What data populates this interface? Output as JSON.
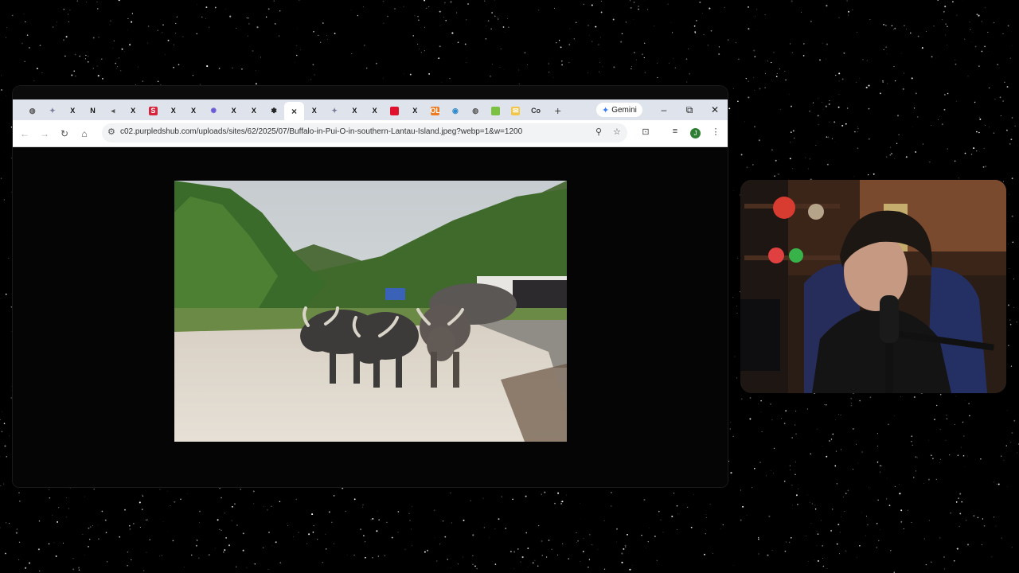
{
  "browser": {
    "tabs": [
      {
        "icon": "globe-icon",
        "glyph": "◍",
        "color": "#555555"
      },
      {
        "icon": "puzzle-favicon-icon",
        "glyph": "✦",
        "color": "#7a7a9a"
      },
      {
        "icon": "x-favicon-icon",
        "glyph": "X",
        "color": "#111111"
      },
      {
        "icon": "notion-favicon-icon",
        "glyph": "N",
        "color": "#111111"
      },
      {
        "icon": "speaker-favicon-icon",
        "glyph": "◂",
        "color": "#555555"
      },
      {
        "icon": "x-favicon-icon",
        "glyph": "X",
        "color": "#111111"
      },
      {
        "icon": "s-favicon-icon",
        "glyph": "S",
        "color": "#d6243c"
      },
      {
        "icon": "x-favicon-icon",
        "glyph": "X",
        "color": "#111111"
      },
      {
        "icon": "x-favicon-icon",
        "glyph": "X",
        "color": "#111111"
      },
      {
        "icon": "gear-favicon-icon",
        "glyph": "✺",
        "color": "#6b5bd6"
      },
      {
        "icon": "x-favicon-icon",
        "glyph": "X",
        "color": "#111111"
      },
      {
        "icon": "x-favicon-icon",
        "glyph": "X",
        "color": "#111111"
      },
      {
        "icon": "paw-favicon-icon",
        "glyph": "✽",
        "color": "#222222"
      },
      {
        "icon": "close-icon",
        "glyph": "×",
        "color": "#333333",
        "active": true
      },
      {
        "icon": "x-favicon-icon",
        "glyph": "X",
        "color": "#111111"
      },
      {
        "icon": "puzzle-favicon-icon",
        "glyph": "✦",
        "color": "#7a7a9a"
      },
      {
        "icon": "x-favicon-icon",
        "glyph": "X",
        "color": "#111111"
      },
      {
        "icon": "x-favicon-icon",
        "glyph": "X",
        "color": "#111111"
      },
      {
        "icon": "red-square-favicon-icon",
        "glyph": "",
        "color": "#e0102e"
      },
      {
        "icon": "x-favicon-icon",
        "glyph": "X",
        "color": "#111111"
      },
      {
        "icon": "orange-favicon-icon",
        "glyph": "OL",
        "color": "#ee7b22"
      },
      {
        "icon": "circle-favicon-icon",
        "glyph": "◉",
        "color": "#2f8ac9"
      },
      {
        "icon": "globe-icon",
        "glyph": "◍",
        "color": "#555555"
      },
      {
        "icon": "green-square-favicon-icon",
        "glyph": "",
        "color": "#7cc242"
      },
      {
        "icon": "yellow-favicon-icon",
        "glyph": "✉",
        "color": "#f3c64a"
      },
      {
        "icon": "co-favicon-icon",
        "glyph": "Co",
        "color": "#333333"
      }
    ],
    "new_tab": "+",
    "gemini_label": "Gemini",
    "url": "c02.purpledshub.com/uploads/sites/62/2025/07/Buffalo-in-Pui-O-in-southern-Lantau-Island.jpeg?webp=1&w=1200",
    "profile_initial": "J"
  },
  "colors": {
    "tabstrip": "#dfe3eb",
    "toolbar": "#ffffff",
    "viewport": "#050505"
  }
}
